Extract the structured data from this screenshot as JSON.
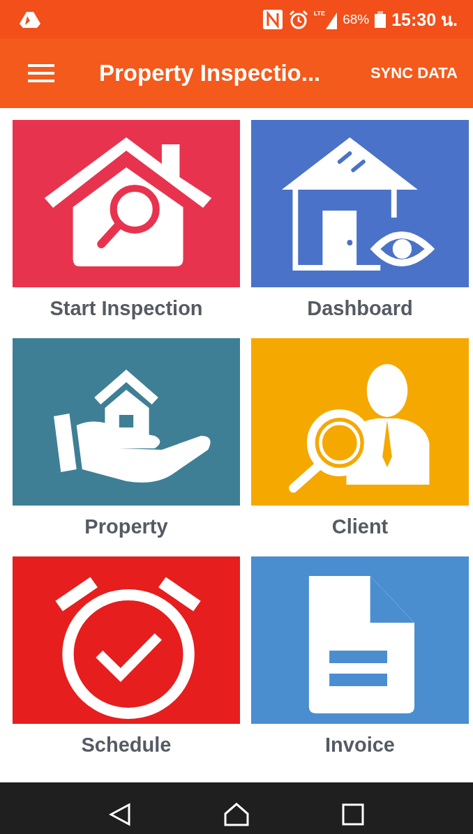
{
  "status_bar": {
    "network": "LTE",
    "battery": "68%",
    "time": "15:30 น."
  },
  "app_bar": {
    "title": "Property Inspectio...",
    "action": "SYNC DATA"
  },
  "tiles": [
    {
      "label": "Start Inspection",
      "kind": "house-search",
      "color": "#e8334f"
    },
    {
      "label": "Dashboard",
      "kind": "house-eye",
      "color": "#4a72c8"
    },
    {
      "label": "Property",
      "kind": "hand-house",
      "color": "#3e7f95"
    },
    {
      "label": "Client",
      "kind": "person-search",
      "color": "#f5a800"
    },
    {
      "label": "Schedule",
      "kind": "alarm-check",
      "color": "#e61e1e"
    },
    {
      "label": "Invoice",
      "kind": "document",
      "color": "#4a8ed0"
    }
  ]
}
